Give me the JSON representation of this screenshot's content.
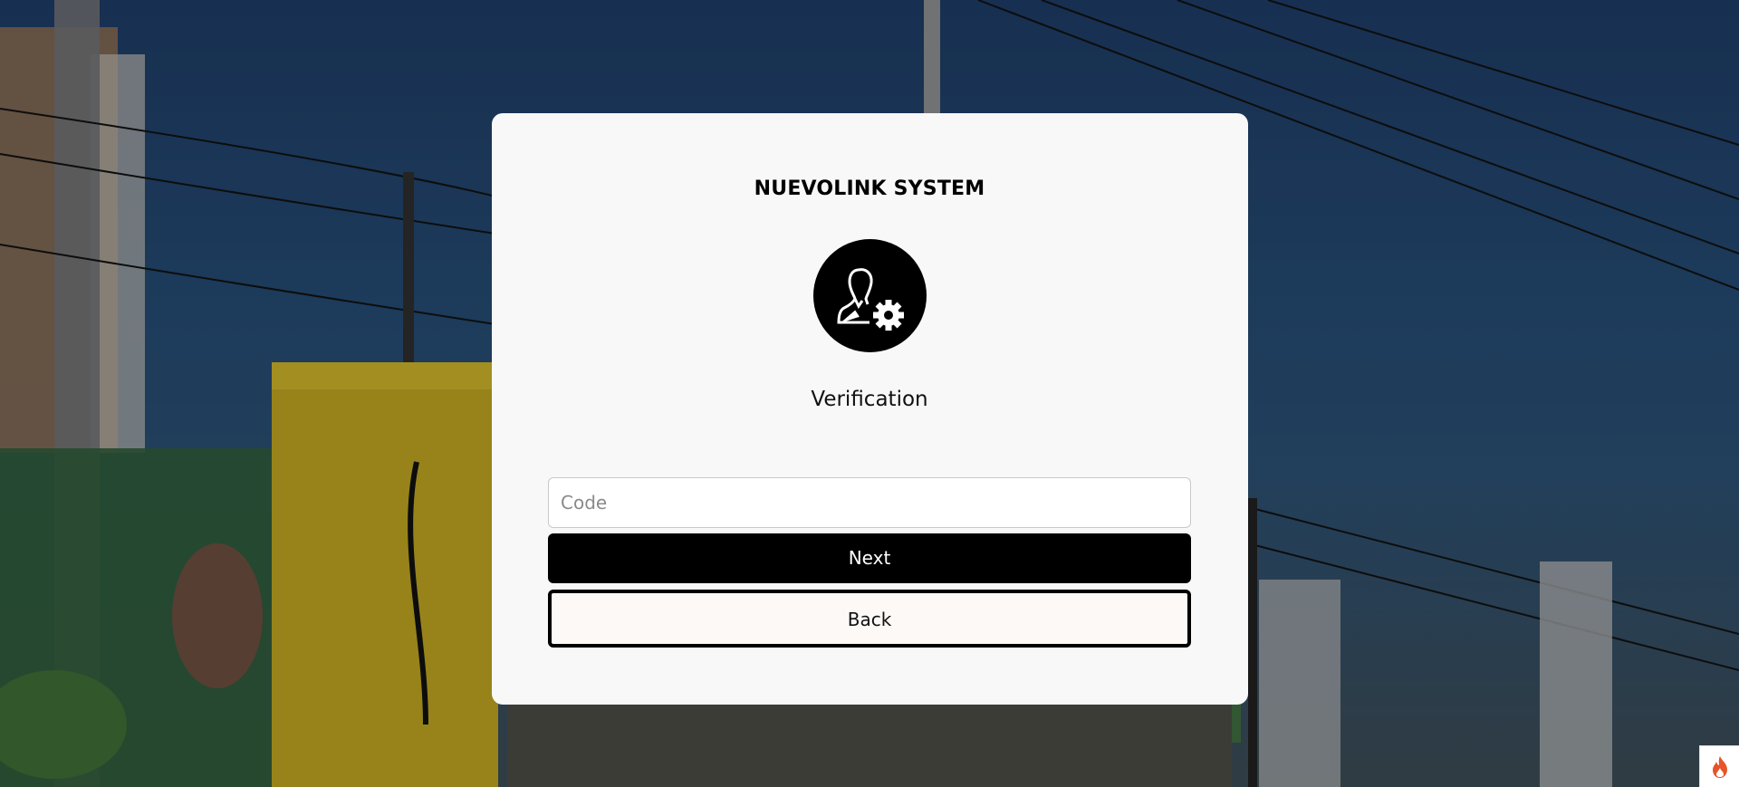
{
  "app": {
    "title": "NUEVOLINK SYSTEM",
    "subtitle": "Verification"
  },
  "form": {
    "code_placeholder": "Code",
    "code_value": "",
    "next_label": "Next",
    "back_label": "Back"
  },
  "icons": {
    "avatar": "user-gear-icon",
    "corner": "flame-icon"
  },
  "colors": {
    "card": "#f8f8f8",
    "primary_button": "#000000",
    "corner_icon": "#e8542a"
  }
}
